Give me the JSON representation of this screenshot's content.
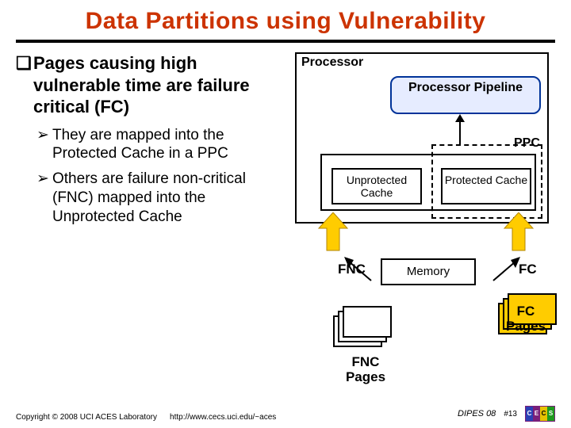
{
  "title": "Data Partitions using Vulnerability",
  "bullets": {
    "main": {
      "symbol": "❑",
      "text_a": "Pages causing high vulnerable time",
      "text_b": " are failure critical (FC)"
    },
    "sub1": {
      "symbol": "➢",
      "text": "They are mapped into the Protected Cache in a PPC"
    },
    "sub2": {
      "symbol": "➢",
      "text": "Others are failure non-critical (FNC) mapped into the Unprotected Cache"
    }
  },
  "diagram": {
    "processor": "Processor",
    "pipeline": "Processor Pipeline",
    "ppc": "PPC",
    "unprotected": "Unprotected Cache",
    "protected": "Protected Cache",
    "memory": "Memory",
    "fnc": "FNC",
    "fc": "FC",
    "fnc_pages": "FNC Pages",
    "fc_pages_a": "FC",
    "fc_pages_b": "Pages"
  },
  "footer": {
    "copyright": "Copyright © 2008 UCI ACES Laboratory",
    "url": "http://www.cecs.uci.edu/~aces",
    "conf": "DIPES 08",
    "slide_no": "#13",
    "logo": [
      "C",
      "E",
      "C",
      "S"
    ]
  }
}
